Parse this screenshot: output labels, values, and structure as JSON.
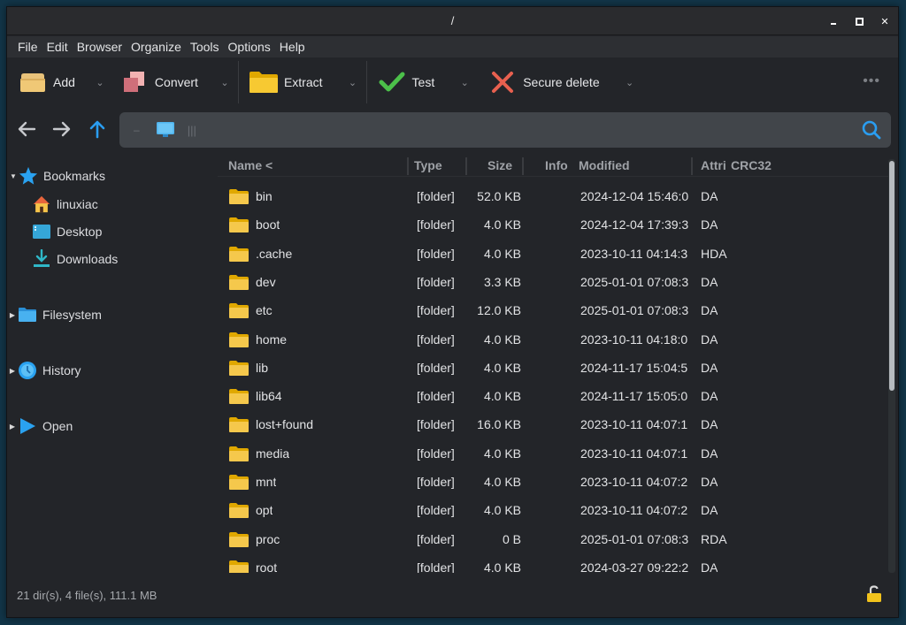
{
  "window": {
    "title": "/"
  },
  "window_controls": {
    "minimize": "minimize",
    "maximize": "maximize",
    "close": "✕"
  },
  "menu": [
    "File",
    "Edit",
    "Browser",
    "Organize",
    "Tools",
    "Options",
    "Help"
  ],
  "toolbar": {
    "add": "Add",
    "convert": "Convert",
    "extract": "Extract",
    "test": "Test",
    "secure_delete": "Secure delete",
    "dropdown_glyph": "⌄",
    "more_glyph": "•••"
  },
  "navigation": {
    "back_icon": "arrow-left-icon",
    "forward_icon": "arrow-right-icon",
    "up_icon": "arrow-up-icon",
    "path_separator": "–",
    "path_text": "|||",
    "search_icon": "search-icon"
  },
  "sidebar": {
    "bookmarks": {
      "label": "Bookmarks",
      "expanded": true,
      "items": [
        {
          "label": "linuxiac",
          "icon": "home-icon"
        },
        {
          "label": "Desktop",
          "icon": "desktop-icon"
        },
        {
          "label": "Downloads",
          "icon": "download-icon"
        }
      ]
    },
    "filesystem": {
      "label": "Filesystem",
      "expanded": false
    },
    "history": {
      "label": "History",
      "expanded": false
    },
    "open": {
      "label": "Open",
      "expanded": false
    },
    "expanded_glyph": "▼",
    "collapsed_glyph": "▶"
  },
  "file_list": {
    "columns": {
      "name": "Name <",
      "type": "Type",
      "size": "Size",
      "info": "Info",
      "modified": "Modified",
      "attributes": "Attri",
      "crc32": "CRC32"
    },
    "rows": [
      {
        "name": "bin",
        "type": "[folder]",
        "size": "52.0 KB",
        "info": "",
        "modified": "2024-12-04 15:46:0",
        "attr": "DA",
        "crc": ""
      },
      {
        "name": "boot",
        "type": "[folder]",
        "size": "4.0 KB",
        "info": "",
        "modified": "2024-12-04 17:39:3",
        "attr": "DA",
        "crc": ""
      },
      {
        "name": ".cache",
        "type": "[folder]",
        "size": "4.0 KB",
        "info": "",
        "modified": "2023-10-11 04:14:3",
        "attr": "HDA",
        "crc": ""
      },
      {
        "name": "dev",
        "type": "[folder]",
        "size": "3.3 KB",
        "info": "",
        "modified": "2025-01-01 07:08:3",
        "attr": "DA",
        "crc": ""
      },
      {
        "name": "etc",
        "type": "[folder]",
        "size": "12.0 KB",
        "info": "",
        "modified": "2025-01-01 07:08:3",
        "attr": "DA",
        "crc": ""
      },
      {
        "name": "home",
        "type": "[folder]",
        "size": "4.0 KB",
        "info": "",
        "modified": "2023-10-11 04:18:0",
        "attr": "DA",
        "crc": ""
      },
      {
        "name": "lib",
        "type": "[folder]",
        "size": "4.0 KB",
        "info": "",
        "modified": "2024-11-17 15:04:5",
        "attr": "DA",
        "crc": ""
      },
      {
        "name": "lib64",
        "type": "[folder]",
        "size": "4.0 KB",
        "info": "",
        "modified": "2024-11-17 15:05:0",
        "attr": "DA",
        "crc": ""
      },
      {
        "name": "lost+found",
        "type": "[folder]",
        "size": "16.0 KB",
        "info": "",
        "modified": "2023-10-11 04:07:1",
        "attr": "DA",
        "crc": ""
      },
      {
        "name": "media",
        "type": "[folder]",
        "size": "4.0 KB",
        "info": "",
        "modified": "2023-10-11 04:07:1",
        "attr": "DA",
        "crc": ""
      },
      {
        "name": "mnt",
        "type": "[folder]",
        "size": "4.0 KB",
        "info": "",
        "modified": "2023-10-11 04:07:2",
        "attr": "DA",
        "crc": ""
      },
      {
        "name": "opt",
        "type": "[folder]",
        "size": "4.0 KB",
        "info": "",
        "modified": "2023-10-11 04:07:2",
        "attr": "DA",
        "crc": ""
      },
      {
        "name": "proc",
        "type": "[folder]",
        "size": "0 B",
        "info": "",
        "modified": "2025-01-01 07:08:3",
        "attr": "RDA",
        "crc": ""
      },
      {
        "name": "root",
        "type": "[folder]",
        "size": "4.0 KB",
        "info": "",
        "modified": "2024-03-27 09:22:2",
        "attr": "DA",
        "crc": ""
      }
    ]
  },
  "scroll": {
    "visible_fraction": 0.56,
    "position": 0.0
  },
  "status": {
    "summary": "21 dir(s), 4 file(s), 111.1 MB",
    "lock_icon": "unlocked-padlock-icon"
  },
  "colors": {
    "folder": "#f5c84c",
    "accent_blue": "#1e9be8",
    "test_green": "#4cc04a",
    "delete_red": "#e8604f",
    "background": "#232529"
  }
}
